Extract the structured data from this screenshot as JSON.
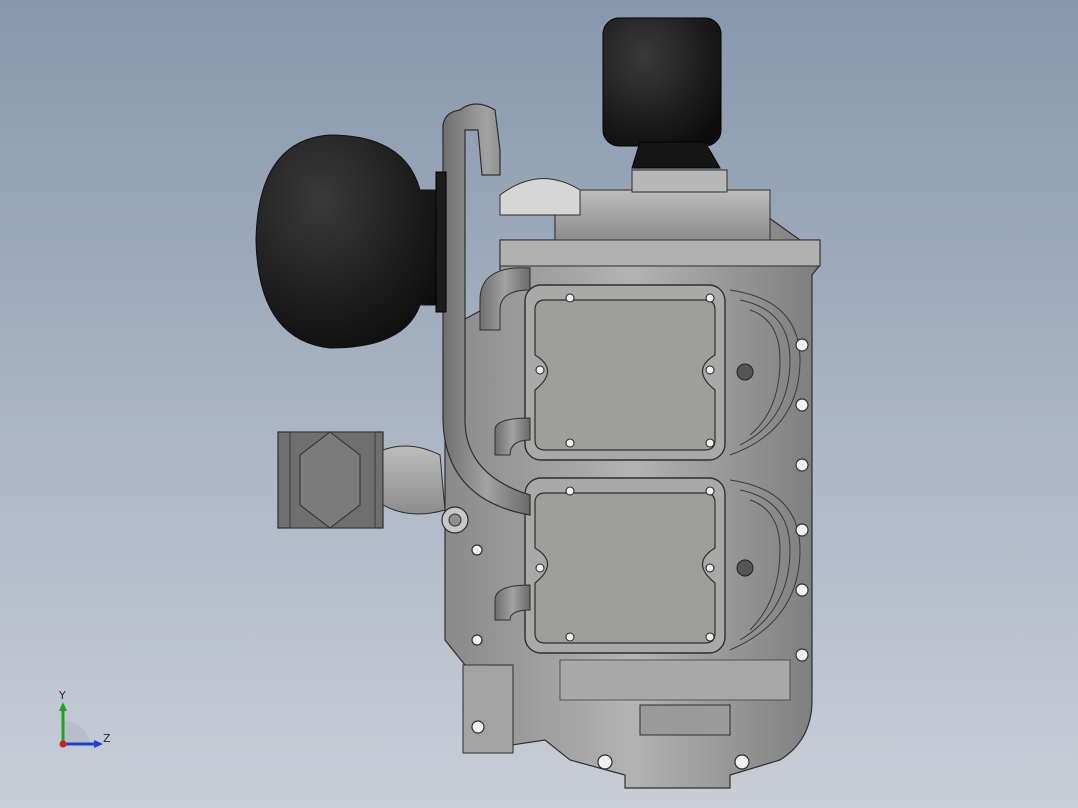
{
  "viewport": {
    "background_top": "#8797ad",
    "background_bottom": "#c9ced8"
  },
  "model": {
    "icon": "engine-assembly-3d-model"
  },
  "triad": {
    "y_label": "Y",
    "z_label": "Z",
    "x_color": "#cc1f1f",
    "y_color": "#1fa31f",
    "z_color": "#1f3fcc"
  }
}
